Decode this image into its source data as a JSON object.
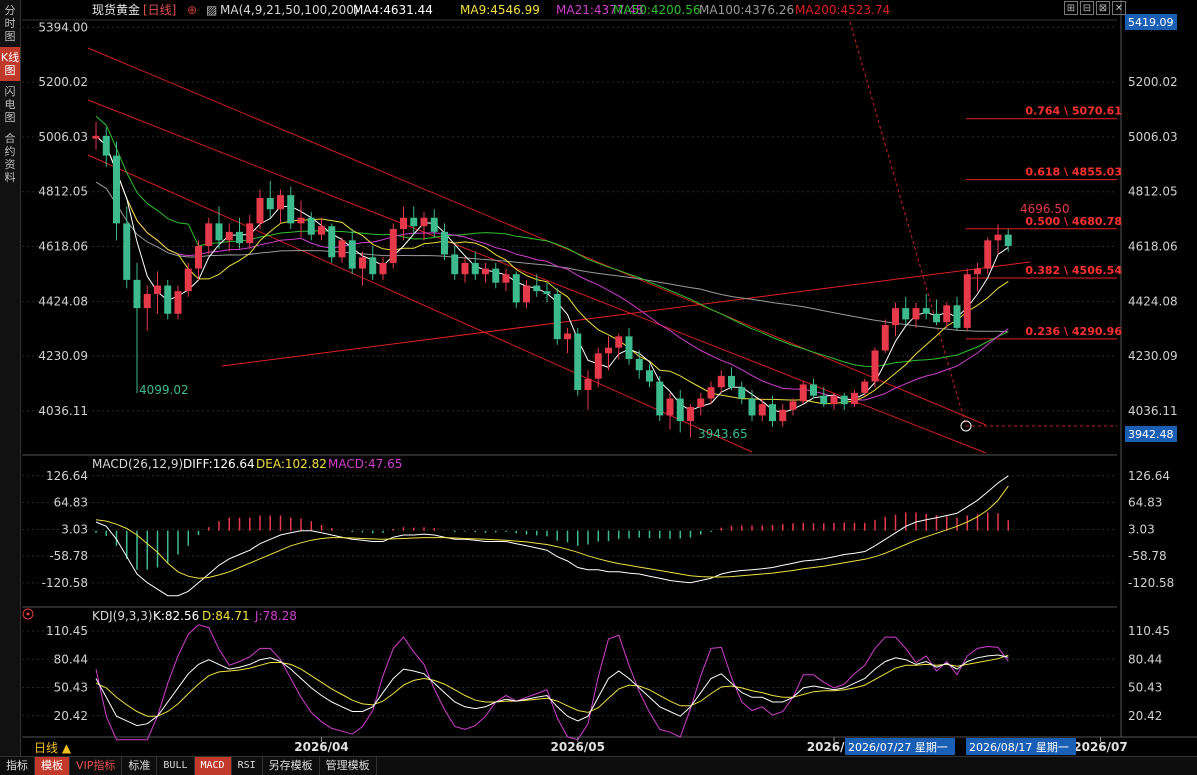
{
  "left_tabs": [
    "分时图",
    "K线图",
    "闪电图",
    "合约资料"
  ],
  "header": {
    "instrument": "现货黄金",
    "period": "[日线]",
    "ma_params": "MA(4,9,21,50,100,200)",
    "ma4": "MA4:4631.44",
    "ma9": "MA9:4546.99",
    "ma21": "MA21:4377.48",
    "ma50": "MA50:4200.56",
    "ma100": "MA100:4376.26",
    "ma200": "MA200:4523.74"
  },
  "window_buttons": [
    "⊞",
    "⊟",
    "⊠",
    "✕"
  ],
  "price_axis": {
    "ticks": [
      "5394.00",
      "5200.02",
      "5006.03",
      "4812.05",
      "4618.06",
      "4424.08",
      "4230.09",
      "4036.11"
    ],
    "right_ticks": [
      "5200.02",
      "5006.03",
      "4812.05",
      "4618.06",
      "4424.08",
      "4230.09",
      "4036.11"
    ],
    "top_box": "5419.09",
    "bottom_box": "3942.48"
  },
  "price_range": [
    3880,
    5420
  ],
  "fib_levels": [
    {
      "label": "0.764 \\ 5070.61",
      "price": 5070.61
    },
    {
      "label": "0.618 \\ 4855.03",
      "price": 4855.03
    },
    {
      "label": "0.500 \\ 4680.78",
      "price": 4680.78
    },
    {
      "label": "0.382 \\ 4506.54",
      "price": 4506.54
    },
    {
      "label": "0.236 \\ 4290.96",
      "price": 4290.96
    }
  ],
  "annotations": {
    "low1": "4099.02",
    "low2": "3943.65",
    "high": "4696.50"
  },
  "macd": {
    "title": "MACD(26,12,9)",
    "diff": "DIFF:126.64",
    "dea": "DEA:102.82",
    "macd": "MACD:47.65",
    "ticks": [
      "126.64",
      "64.83",
      "3.03",
      "-58.78",
      "-120.58"
    ],
    "range": [
      -160,
      140
    ]
  },
  "kdj": {
    "title": "KDJ(9,3,3)",
    "k": "K:82.56",
    "d": "D:84.71",
    "j": "J:78.28",
    "ticks": [
      "110.45",
      "80.44",
      "50.43",
      "20.42"
    ],
    "range": [
      0,
      120
    ]
  },
  "period_label": "日线 ▲",
  "x_axis_labels": [
    "2026/04",
    "2026/05",
    "2026/06",
    "2026/07"
  ],
  "date_boxes": [
    "2026/07/27 星期一",
    "2026/08/17 星期一"
  ],
  "bottom_tabs": [
    "指标",
    "模板",
    "VIP指标",
    "标准",
    "BULL",
    "MACD",
    "RSI",
    "另存模板",
    "管理模板"
  ],
  "colors": {
    "up": "#e6394a",
    "down": "#3dbb8f",
    "ma4": "#ffffff",
    "ma9": "#f0e040",
    "ma21": "#d040d0",
    "ma50": "#30c030",
    "ma100": "#9a9a9a",
    "ma200": "#e02020",
    "diff": "#ffffff",
    "dea": "#f0e040",
    "kdj_k": "#ffffff",
    "kdj_d": "#f0e040",
    "kdj_j": "#d040d0"
  },
  "chart_data": {
    "type": "candlestick",
    "title": "现货黄金 [日线]",
    "x_label_positions": {
      "2026/04": 22,
      "2026/05": 47,
      "2026/06": 72,
      "2026/07": 98
    },
    "candles": [
      [
        5000,
        5060,
        4960,
        5010
      ],
      [
        5010,
        5040,
        4900,
        4940
      ],
      [
        4940,
        4990,
        4640,
        4700
      ],
      [
        4700,
        4760,
        4470,
        4500
      ],
      [
        4500,
        4560,
        4099,
        4400
      ],
      [
        4400,
        4480,
        4320,
        4450
      ],
      [
        4450,
        4530,
        4380,
        4480
      ],
      [
        4480,
        4500,
        4360,
        4380
      ],
      [
        4380,
        4480,
        4360,
        4460
      ],
      [
        4460,
        4560,
        4440,
        4540
      ],
      [
        4540,
        4640,
        4500,
        4620
      ],
      [
        4620,
        4720,
        4590,
        4700
      ],
      [
        4700,
        4760,
        4610,
        4640
      ],
      [
        4640,
        4700,
        4600,
        4670
      ],
      [
        4670,
        4720,
        4610,
        4630
      ],
      [
        4630,
        4730,
        4610,
        4700
      ],
      [
        4700,
        4820,
        4680,
        4790
      ],
      [
        4790,
        4850,
        4720,
        4750
      ],
      [
        4750,
        4820,
        4700,
        4800
      ],
      [
        4800,
        4830,
        4680,
        4700
      ],
      [
        4700,
        4780,
        4650,
        4720
      ],
      [
        4720,
        4740,
        4640,
        4660
      ],
      [
        4660,
        4720,
        4640,
        4690
      ],
      [
        4690,
        4700,
        4560,
        4580
      ],
      [
        4580,
        4650,
        4560,
        4640
      ],
      [
        4640,
        4680,
        4520,
        4540
      ],
      [
        4540,
        4600,
        4480,
        4580
      ],
      [
        4580,
        4620,
        4500,
        4520
      ],
      [
        4520,
        4580,
        4500,
        4560
      ],
      [
        4560,
        4700,
        4540,
        4680
      ],
      [
        4680,
        4760,
        4640,
        4720
      ],
      [
        4720,
        4760,
        4660,
        4690
      ],
      [
        4690,
        4740,
        4640,
        4720
      ],
      [
        4720,
        4750,
        4650,
        4670
      ],
      [
        4670,
        4700,
        4570,
        4590
      ],
      [
        4590,
        4620,
        4500,
        4520
      ],
      [
        4520,
        4580,
        4490,
        4560
      ],
      [
        4560,
        4600,
        4500,
        4520
      ],
      [
        4520,
        4560,
        4490,
        4540
      ],
      [
        4540,
        4560,
        4470,
        4490
      ],
      [
        4490,
        4540,
        4460,
        4520
      ],
      [
        4520,
        4530,
        4400,
        4420
      ],
      [
        4420,
        4500,
        4400,
        4480
      ],
      [
        4480,
        4520,
        4440,
        4460
      ],
      [
        4460,
        4490,
        4420,
        4450
      ],
      [
        4450,
        4470,
        4270,
        4290
      ],
      [
        4290,
        4330,
        4240,
        4310
      ],
      [
        4310,
        4330,
        4090,
        4110
      ],
      [
        4110,
        4180,
        4040,
        4150
      ],
      [
        4150,
        4260,
        4120,
        4240
      ],
      [
        4240,
        4300,
        4180,
        4260
      ],
      [
        4260,
        4310,
        4220,
        4300
      ],
      [
        4300,
        4330,
        4200,
        4220
      ],
      [
        4220,
        4250,
        4150,
        4180
      ],
      [
        4180,
        4200,
        4120,
        4140
      ],
      [
        4140,
        4160,
        4000,
        4020
      ],
      [
        4020,
        4100,
        3970,
        4080
      ],
      [
        4080,
        4110,
        3960,
        4000
      ],
      [
        4000,
        4060,
        3943,
        4050
      ],
      [
        4050,
        4100,
        4020,
        4080
      ],
      [
        4080,
        4140,
        4060,
        4120
      ],
      [
        4120,
        4180,
        4100,
        4160
      ],
      [
        4160,
        4190,
        4110,
        4120
      ],
      [
        4120,
        4140,
        4060,
        4080
      ],
      [
        4080,
        4110,
        4000,
        4020
      ],
      [
        4020,
        4080,
        4000,
        4060
      ],
      [
        4060,
        4090,
        3980,
        4000
      ],
      [
        4000,
        4060,
        3980,
        4040
      ],
      [
        4040,
        4080,
        4020,
        4070
      ],
      [
        4070,
        4140,
        4060,
        4130
      ],
      [
        4130,
        4150,
        4080,
        4090
      ],
      [
        4090,
        4120,
        4050,
        4060
      ],
      [
        4060,
        4100,
        4040,
        4090
      ],
      [
        4090,
        4100,
        4040,
        4060
      ],
      [
        4060,
        4110,
        4050,
        4100
      ],
      [
        4100,
        4150,
        4090,
        4140
      ],
      [
        4140,
        4260,
        4120,
        4250
      ],
      [
        4250,
        4360,
        4240,
        4340
      ],
      [
        4340,
        4420,
        4300,
        4400
      ],
      [
        4400,
        4440,
        4340,
        4360
      ],
      [
        4360,
        4420,
        4330,
        4400
      ],
      [
        4400,
        4450,
        4360,
        4380
      ],
      [
        4380,
        4430,
        4340,
        4350
      ],
      [
        4350,
        4420,
        4330,
        4410
      ],
      [
        4410,
        4440,
        4320,
        4330
      ],
      [
        4330,
        4540,
        4320,
        4520
      ],
      [
        4520,
        4560,
        4460,
        4540
      ],
      [
        4540,
        4650,
        4520,
        4640
      ],
      [
        4640,
        4696.5,
        4590,
        4660
      ],
      [
        4660,
        4680,
        4600,
        4620
      ]
    ],
    "macd_diff": [
      20,
      10,
      -20,
      -60,
      -100,
      -120,
      -135,
      -150,
      -150,
      -140,
      -120,
      -100,
      -80,
      -65,
      -55,
      -45,
      -30,
      -20,
      -10,
      -5,
      0,
      0,
      -5,
      -10,
      -15,
      -20,
      -22,
      -25,
      -25,
      -15,
      -10,
      -10,
      -8,
      -10,
      -15,
      -20,
      -20,
      -22,
      -25,
      -25,
      -25,
      -30,
      -35,
      -40,
      -45,
      -60,
      -70,
      -85,
      -90,
      -90,
      -95,
      -95,
      -98,
      -100,
      -105,
      -110,
      -115,
      -118,
      -120,
      -115,
      -110,
      -100,
      -95,
      -92,
      -90,
      -88,
      -85,
      -80,
      -75,
      -70,
      -68,
      -65,
      -60,
      -55,
      -52,
      -48,
      -35,
      -20,
      -5,
      10,
      20,
      25,
      30,
      35,
      40,
      55,
      70,
      90,
      110,
      126.64
    ],
    "macd_dea": [
      25,
      22,
      15,
      5,
      -10,
      -30,
      -50,
      -75,
      -95,
      -105,
      -110,
      -108,
      -102,
      -95,
      -85,
      -75,
      -65,
      -55,
      -45,
      -35,
      -28,
      -22,
      -18,
      -16,
      -16,
      -17,
      -18,
      -19,
      -20,
      -19,
      -18,
      -17,
      -16,
      -16,
      -16,
      -17,
      -18,
      -19,
      -20,
      -21,
      -22,
      -24,
      -26,
      -29,
      -32,
      -37,
      -43,
      -50,
      -58,
      -65,
      -71,
      -76,
      -80,
      -84,
      -88,
      -92,
      -96,
      -100,
      -104,
      -106,
      -107,
      -107,
      -106,
      -104,
      -102,
      -100,
      -98,
      -95,
      -92,
      -88,
      -85,
      -82,
      -78,
      -74,
      -70,
      -66,
      -60,
      -52,
      -42,
      -32,
      -22,
      -14,
      -6,
      2,
      10,
      20,
      32,
      48,
      70,
      102.82
    ],
    "macd_hist": [
      -10,
      -24,
      -70,
      -130,
      -180,
      -180,
      -170,
      -150,
      -110,
      -70,
      -20,
      16,
      44,
      60,
      60,
      60,
      70,
      70,
      70,
      60,
      56,
      44,
      26,
      12,
      2,
      -6,
      -8,
      -12,
      -10,
      8,
      16,
      14,
      16,
      12,
      2,
      -6,
      -4,
      -6,
      -10,
      -8,
      -6,
      -12,
      -18,
      -22,
      -26,
      -46,
      -54,
      -70,
      -64,
      -50,
      -48,
      -38,
      -36,
      -32,
      -34,
      -36,
      -38,
      -36,
      -32,
      -18,
      -6,
      14,
      22,
      24,
      24,
      24,
      26,
      30,
      34,
      36,
      34,
      34,
      36,
      38,
      36,
      36,
      50,
      64,
      74,
      84,
      84,
      78,
      72,
      66,
      60,
      70,
      76,
      84,
      80,
      47.65
    ],
    "kdj_k": [
      60,
      40,
      20,
      15,
      10,
      12,
      20,
      35,
      50,
      65,
      75,
      80,
      75,
      70,
      72,
      75,
      80,
      82,
      78,
      70,
      60,
      50,
      42,
      35,
      30,
      25,
      25,
      30,
      45,
      60,
      70,
      68,
      65,
      55,
      45,
      35,
      30,
      28,
      30,
      35,
      38,
      36,
      38,
      40,
      42,
      30,
      20,
      15,
      20,
      40,
      60,
      68,
      60,
      50,
      40,
      30,
      25,
      20,
      30,
      45,
      60,
      65,
      55,
      45,
      40,
      40,
      35,
      35,
      40,
      50,
      52,
      50,
      48,
      50,
      55,
      60,
      70,
      78,
      82,
      80,
      75,
      78,
      72,
      76,
      70,
      78,
      82,
      84,
      85,
      82.56
    ],
    "kdj_d": [
      55,
      50,
      40,
      32,
      25,
      20,
      20,
      25,
      33,
      44,
      54,
      63,
      67,
      68,
      69,
      71,
      74,
      77,
      77,
      75,
      70,
      63,
      56,
      49,
      43,
      37,
      33,
      32,
      36,
      44,
      53,
      58,
      60,
      58,
      54,
      48,
      42,
      37,
      35,
      35,
      36,
      36,
      37,
      38,
      39,
      36,
      31,
      26,
      24,
      29,
      39,
      49,
      53,
      52,
      48,
      42,
      36,
      31,
      31,
      36,
      44,
      51,
      52,
      50,
      47,
      45,
      42,
      40,
      40,
      43,
      46,
      47,
      47,
      48,
      50,
      53,
      59,
      65,
      71,
      74,
      74,
      75,
      74,
      75,
      73,
      75,
      77,
      79,
      81,
      84.71
    ],
    "kdj_j": [
      70,
      20,
      -20,
      -20,
      -20,
      -10,
      20,
      55,
      84,
      107,
      117,
      114,
      91,
      74,
      78,
      83,
      92,
      92,
      80,
      60,
      40,
      24,
      14,
      7,
      4,
      1,
      9,
      26,
      63,
      92,
      104,
      88,
      75,
      49,
      27,
      9,
      6,
      10,
      20,
      35,
      42,
      36,
      40,
      44,
      48,
      18,
      -2,
      -7,
      12,
      62,
      102,
      106,
      74,
      46,
      24,
      6,
      3,
      -2,
      28,
      63,
      92,
      93,
      61,
      35,
      26,
      30,
      21,
      25,
      40,
      64,
      64,
      56,
      50,
      54,
      65,
      74,
      92,
      104,
      104,
      92,
      77,
      84,
      68,
      78,
      64,
      84,
      92,
      94,
      93,
      78.28
    ]
  }
}
